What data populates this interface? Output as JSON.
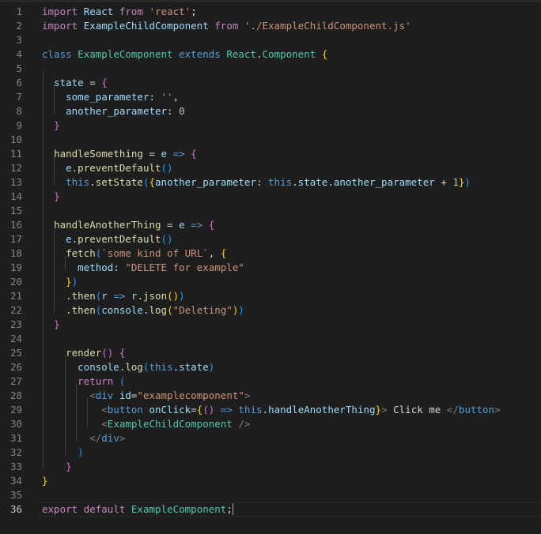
{
  "editor": {
    "line_numbers": [
      "1",
      "2",
      "3",
      "4",
      "5",
      "6",
      "7",
      "8",
      "9",
      "10",
      "11",
      "12",
      "13",
      "14",
      "15",
      "16",
      "17",
      "18",
      "19",
      "20",
      "21",
      "22",
      "23",
      "24",
      "25",
      "26",
      "27",
      "28",
      "29",
      "30",
      "31",
      "32",
      "33",
      "34",
      "35",
      "36"
    ],
    "active_line": "36",
    "lines": {
      "l1": [
        "import",
        " ",
        "React",
        " ",
        "from",
        " ",
        "'react'",
        ";"
      ],
      "l2": [
        "import",
        " ",
        "ExampleChildComponent",
        " ",
        "from",
        " ",
        "'./ExampleChildComponent.js'"
      ],
      "l4": [
        "class",
        " ",
        "ExampleComponent",
        " ",
        "extends",
        " ",
        "React",
        ".",
        "Component",
        " ",
        "{"
      ],
      "l6": [
        "  ",
        "state",
        " = ",
        "{"
      ],
      "l7": [
        "    ",
        "some_parameter",
        ": ",
        "''",
        ","
      ],
      "l8": [
        "    ",
        "another_parameter",
        ": ",
        "0"
      ],
      "l9": [
        "  ",
        "}"
      ],
      "l11": [
        "  ",
        "handleSomething",
        " = ",
        "e",
        " ",
        "=>",
        " ",
        "{"
      ],
      "l12": [
        "    ",
        "e",
        ".",
        "preventDefault",
        "()"
      ],
      "l13": [
        "    ",
        "this",
        ".",
        "setState",
        "(",
        "{",
        "another_parameter",
        ": ",
        "this",
        ".",
        "state",
        ".",
        "another_parameter",
        " + ",
        "1",
        "}",
        ")"
      ],
      "l14": [
        "  ",
        "}"
      ],
      "l16": [
        "  ",
        "handleAnotherThing",
        " = ",
        "e",
        " ",
        "=>",
        " ",
        "{"
      ],
      "l17": [
        "    ",
        "e",
        ".",
        "preventDefault",
        "()"
      ],
      "l18": [
        "    ",
        "fetch",
        "(",
        "`some kind of URL`",
        ", ",
        "{"
      ],
      "l19": [
        "      ",
        "method",
        ": ",
        "\"DELETE for example\""
      ],
      "l20": [
        "    ",
        "}",
        ")"
      ],
      "l21": [
        "    ",
        ".",
        "then",
        "(",
        "r",
        " ",
        "=>",
        " ",
        "r",
        ".",
        "json",
        "()",
        ")"
      ],
      "l22": [
        "    ",
        ".",
        "then",
        "(",
        "console",
        ".",
        "log",
        "(",
        "\"Deleting\"",
        ")",
        ")"
      ],
      "l23": [
        "  ",
        "}"
      ],
      "l25": [
        "    ",
        "render",
        "()",
        " ",
        "{"
      ],
      "l26": [
        "      ",
        "console",
        ".",
        "log",
        "(",
        "this",
        ".",
        "state",
        ")"
      ],
      "l27": [
        "      ",
        "return",
        " ",
        "("
      ],
      "l28": [
        "        ",
        "<",
        "div",
        " ",
        "id",
        "=",
        "\"examplecomponent\"",
        ">"
      ],
      "l29": [
        "          ",
        "<",
        "button",
        " ",
        "onClick",
        "=",
        "{",
        "()",
        " ",
        "=>",
        " ",
        "this",
        ".",
        "handleAnotherThing",
        "}",
        ">",
        " Click me ",
        "</",
        "button",
        ">"
      ],
      "l30": [
        "          ",
        "<",
        "ExampleChildComponent",
        " ",
        "/>"
      ],
      "l31": [
        "        ",
        "</",
        "div",
        ">"
      ],
      "l32": [
        "      ",
        ")"
      ],
      "l33": [
        "    ",
        "}"
      ],
      "l34": [
        "}"
      ],
      "l36": [
        "export",
        " ",
        "default",
        " ",
        "ExampleComponent",
        ";"
      ]
    }
  },
  "colors": {
    "background": "#1e1e1e",
    "line_number": "#858585",
    "keyword": "#c586c0",
    "storage": "#569cd6",
    "variable": "#9cdcfe",
    "class": "#4ec9b0",
    "string": "#ce9178",
    "function": "#dcdcaa",
    "number": "#b5cea8"
  }
}
